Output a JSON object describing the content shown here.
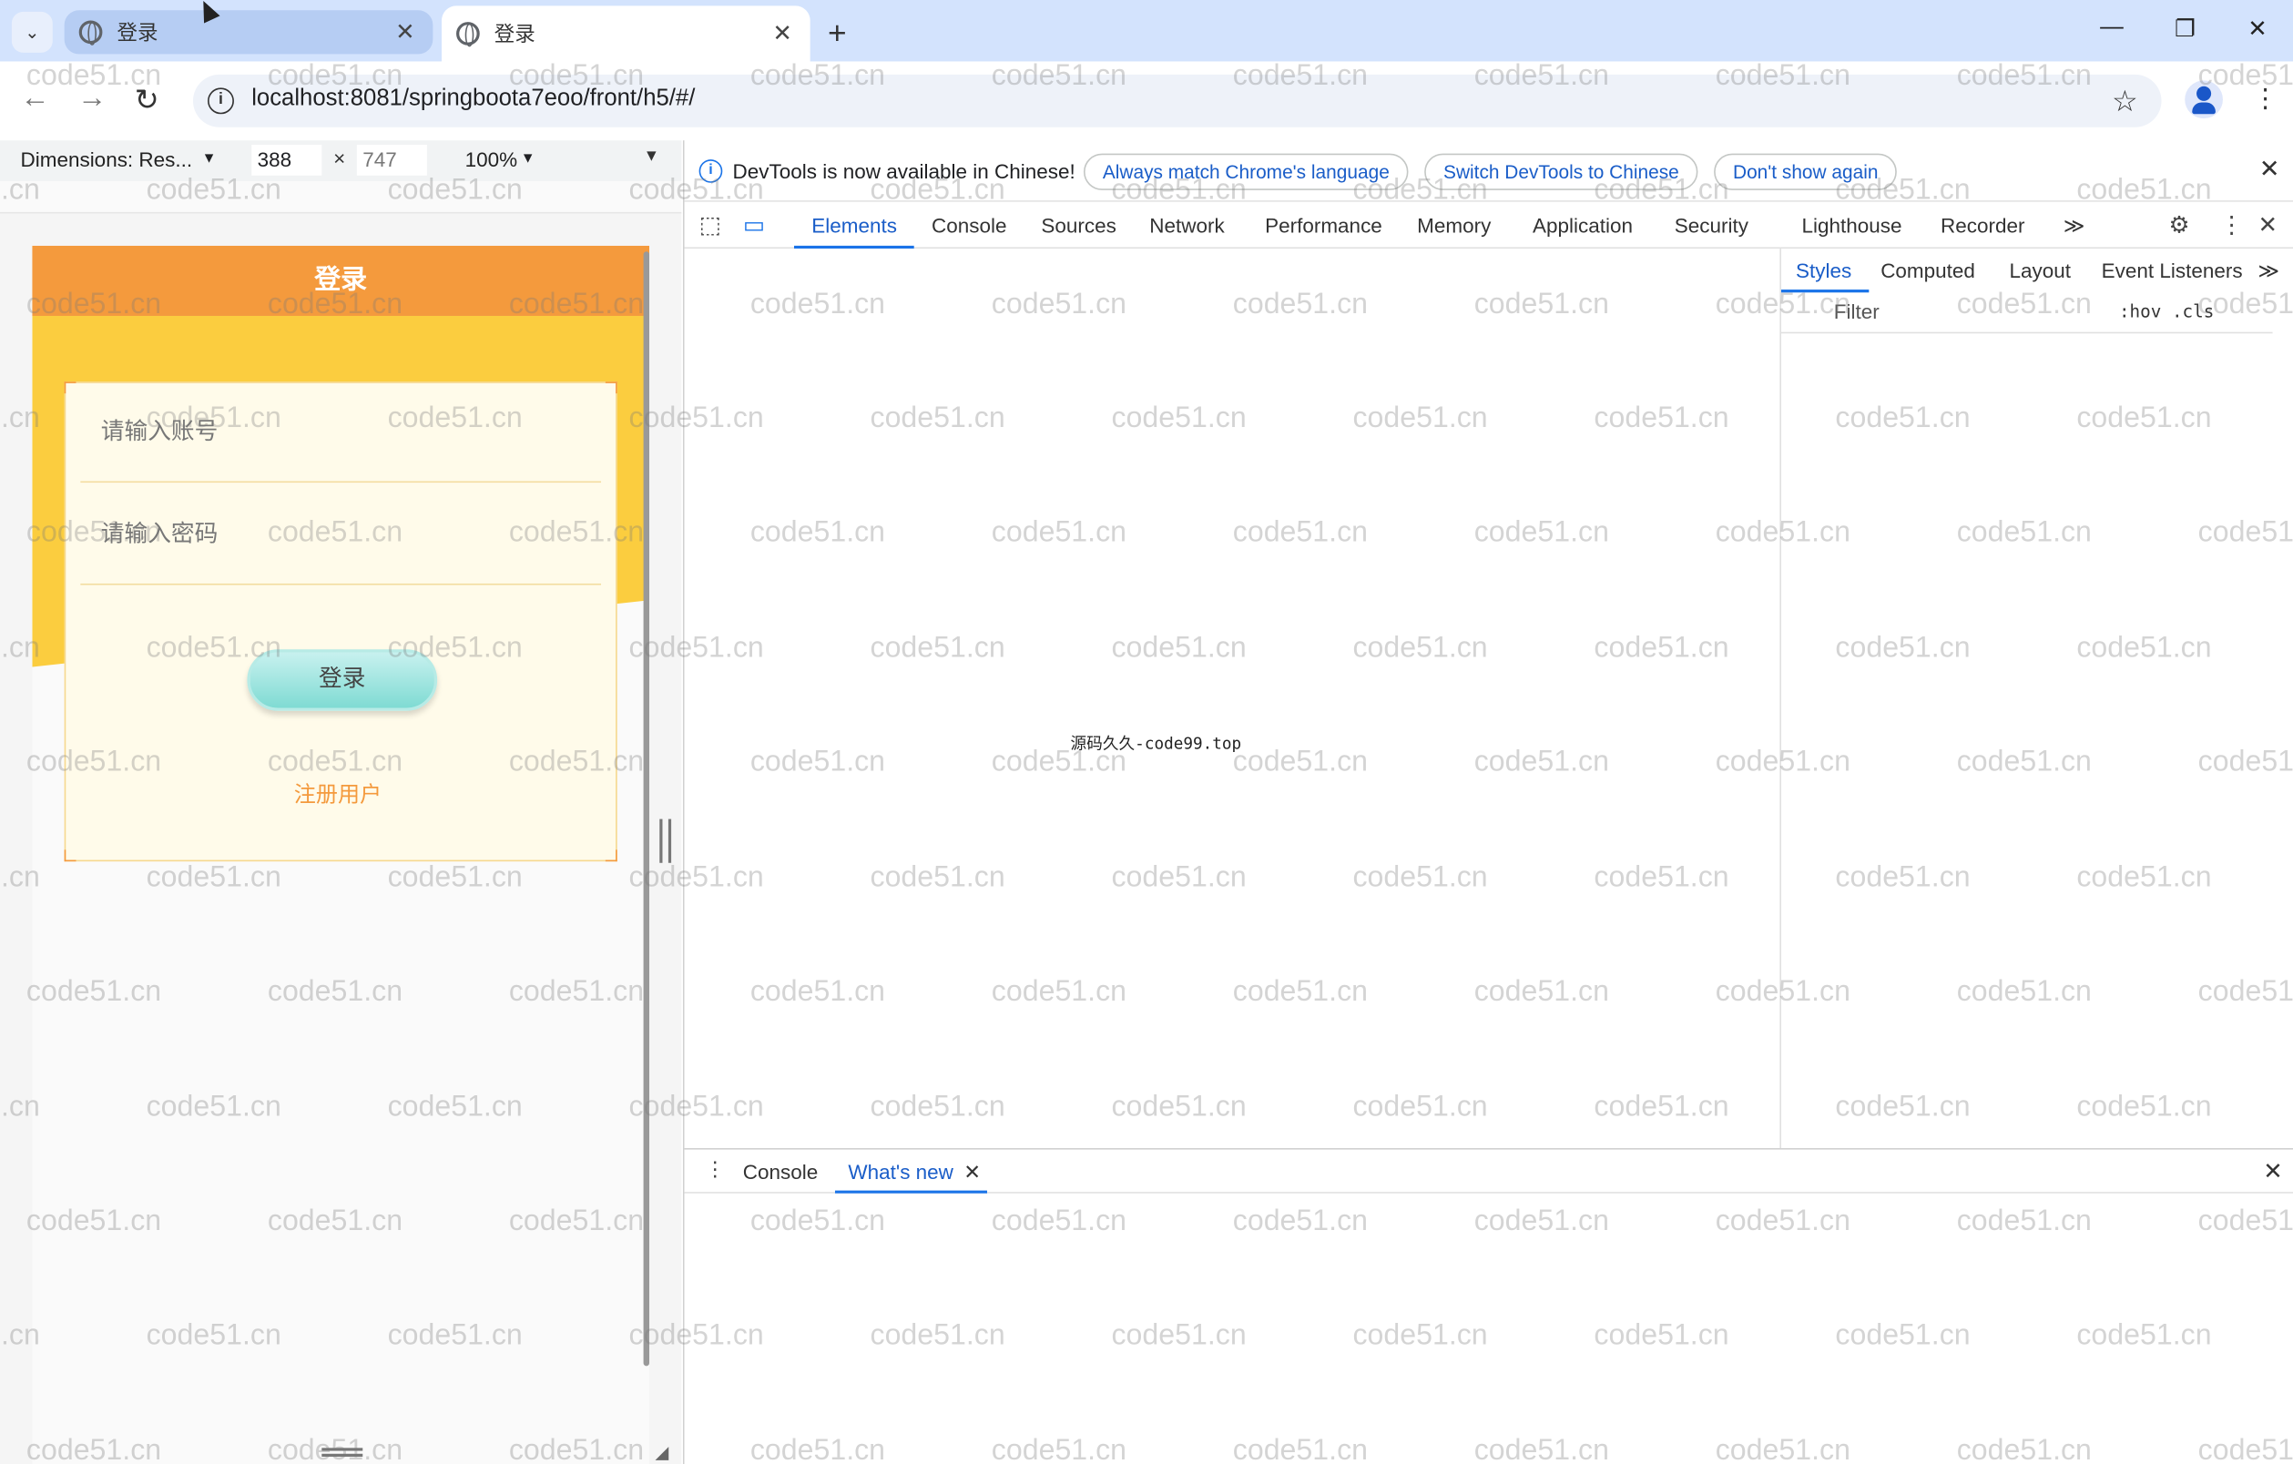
{
  "browser": {
    "tabs": [
      {
        "title": "登录",
        "active": false
      },
      {
        "title": "登录",
        "active": true
      }
    ],
    "new_tab_icon": "plus-icon",
    "url": "localhost:8081/springboota7eoo/front/h5/#/",
    "window_controls": {
      "minimize": "—",
      "restore": "❐",
      "close": "✕"
    },
    "nav": {
      "back": "←",
      "forward": "→",
      "reload": "↻"
    },
    "tab_close_glyph": "✕",
    "star_glyph": "☆",
    "menu_glyph": "⋮"
  },
  "device_toolbar": {
    "dimensions_label": "Dimensions: Res...",
    "width": "388",
    "height": "747",
    "times": "×",
    "zoom": "100%",
    "dropdown_glyph": "▼"
  },
  "mobile_page": {
    "header_title": "登录",
    "account_placeholder": "请输入账号",
    "password_placeholder": "请输入密码",
    "login_button": "登录",
    "register_link": "注册用户",
    "colors": {
      "header": "#f49a3d",
      "accent_bg": "#fbcd3f",
      "button": "#7fdbd3"
    }
  },
  "devtools": {
    "infobar": {
      "message": "DevTools is now available in Chinese!",
      "buttons": [
        "Always match Chrome's language",
        "Switch DevTools to Chinese",
        "Don't show again"
      ],
      "close_glyph": "✕",
      "info_glyph": "i"
    },
    "tabs": [
      "Elements",
      "Console",
      "Sources",
      "Network",
      "Performance",
      "Memory",
      "Application",
      "Security",
      "Lighthouse",
      "Recorder"
    ],
    "active_tab": "Elements",
    "more_tabs_glyph": "≫",
    "elements_center_text": "源码久久-code99.top",
    "styles_tabs": [
      "Styles",
      "Computed",
      "Layout",
      "Event Listeners"
    ],
    "styles_more_glyph": "≫",
    "filter_placeholder": "Filter",
    "filter_controls": ":hov  .cls",
    "drawer": {
      "tabs": [
        "Console",
        "What's new"
      ],
      "active": "What's new",
      "close_glyph": "✕"
    }
  },
  "watermark": "code51.cn"
}
